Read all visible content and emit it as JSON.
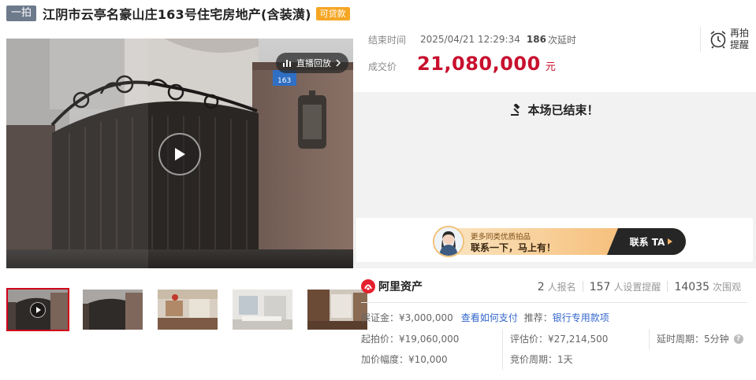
{
  "title": {
    "tag": "一拍",
    "text": "江阴市云亭名豪山庄163号住宅房地产(含装潢)",
    "loan_tag": "可贷款"
  },
  "video": {
    "replay_label": "直播回放",
    "door_plate": "163"
  },
  "auction": {
    "end_label": "结束时间",
    "end_time": "2025/04/21 12:29:34",
    "delay_count": "186",
    "delay_suffix": "次延时",
    "deal_label": "成交价",
    "deal_price": "21,080,000",
    "deal_unit": "元",
    "ended_text": "本场已结束！"
  },
  "remind": {
    "line1": "再拍",
    "line2": "提醒"
  },
  "contact": {
    "line1": "更多同类优质拍品",
    "line2": "联系一下，马上有！",
    "button": "联系 TA"
  },
  "platform": {
    "name": "阿里资产"
  },
  "stats": [
    {
      "num": "2",
      "label": "人报名"
    },
    {
      "num": "157",
      "label": "人设置提醒"
    },
    {
      "num": "14035",
      "label": "次围观"
    }
  ],
  "details": {
    "deposit_label": "保证金：",
    "deposit_value": "¥3,000,000",
    "how_to_pay": "查看如何支付",
    "recommend_label": "推荐：",
    "bank_loan": "银行专用款项",
    "start_label": "起拍价：",
    "start_value": "¥19,060,000",
    "appraise_label": "评估价：",
    "appraise_value": "¥27,214,500",
    "delay_period_label": "延时周期：",
    "delay_period_value": "5分钟",
    "increment_label": "加价幅度：",
    "increment_value": "¥10,000",
    "bid_period_label": "竞价周期：",
    "bid_period_value": "1天"
  },
  "colors": {
    "price": "#c8102e",
    "link": "#3366cc",
    "tag_bg": "#6d7a8c",
    "loan_bg": "#f5a623",
    "thumb_active": "#d0021b"
  }
}
